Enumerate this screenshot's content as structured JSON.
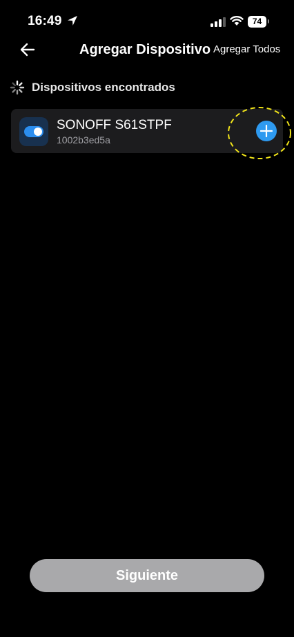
{
  "status_bar": {
    "time": "16:49",
    "battery": "74",
    "icons": [
      "location-arrow-icon",
      "cellular-signal-icon",
      "wifi-icon",
      "battery-icon"
    ]
  },
  "nav": {
    "back_icon": "arrow-left-icon",
    "title": "Agregar Dispositivo",
    "add_all_label": "Agregar Todos"
  },
  "section": {
    "spinner_icon": "loading-spinner-icon",
    "title": "Dispositivos encontrados"
  },
  "devices": [
    {
      "icon": "toggle-switch-icon",
      "name": "SONOFF S61STPF",
      "id": "1002b3ed5a",
      "action_icon": "plus-icon"
    }
  ],
  "footer": {
    "next_label": "Siguiente"
  },
  "colors": {
    "background": "#000000",
    "card": "#1c1c1e",
    "accent_blue": "#2e9af0",
    "highlight_yellow": "#f2e51a",
    "disabled_button": "#a9a9ab"
  }
}
